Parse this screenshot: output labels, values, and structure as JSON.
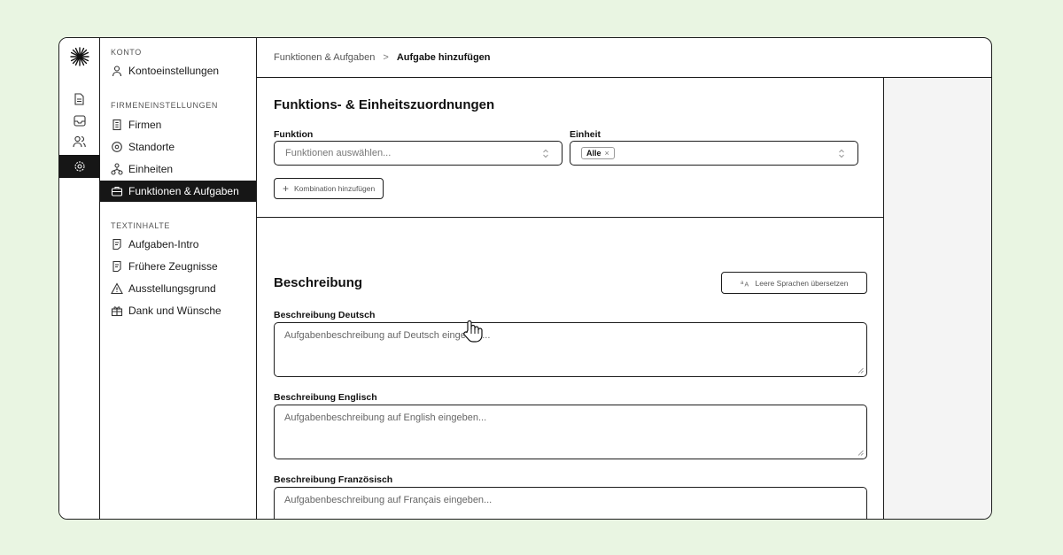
{
  "sidebar": {
    "sections": [
      {
        "title": "KONTO",
        "items": [
          {
            "label": "Kontoeinstellungen",
            "icon": "user-icon"
          }
        ]
      },
      {
        "title": "FIRMENEINSTELLUNGEN",
        "items": [
          {
            "label": "Firmen",
            "icon": "building-icon"
          },
          {
            "label": "Standorte",
            "icon": "map-pin-icon"
          },
          {
            "label": "Einheiten",
            "icon": "hierarchy-icon"
          },
          {
            "label": "Funktionen & Aufgaben",
            "icon": "briefcase-icon",
            "active": true
          }
        ]
      },
      {
        "title": "TEXTINHALTE",
        "items": [
          {
            "label": "Aufgaben-Intro",
            "icon": "text-doc-icon"
          },
          {
            "label": "Frühere Zeugnisse",
            "icon": "text-doc-icon"
          },
          {
            "label": "Ausstellungsgrund",
            "icon": "warning-icon"
          },
          {
            "label": "Dank und Wünsche",
            "icon": "gift-icon"
          }
        ]
      }
    ]
  },
  "breadcrumb": {
    "parent": "Funktionen & Aufgaben",
    "separator": ">",
    "current": "Aufgabe hinzufügen"
  },
  "assignments": {
    "title": "Funktions- & Einheitszuordnungen",
    "function_label": "Funktion",
    "function_placeholder": "Funktionen auswählen...",
    "unit_label": "Einheit",
    "unit_tag": "Alle",
    "unit_tag_remove": "×",
    "add_button": "Kombination hinzufügen"
  },
  "description": {
    "title": "Beschreibung",
    "translate_button": "Leere Sprachen übersetzen",
    "fields": [
      {
        "label": "Beschreibung Deutsch",
        "placeholder": "Aufgabenbeschreibung auf Deutsch eingeben..."
      },
      {
        "label": "Beschreibung Englisch",
        "placeholder": "Aufgabenbeschreibung auf English eingeben..."
      },
      {
        "label": "Beschreibung Französisch",
        "placeholder": "Aufgabenbeschreibung auf Français eingeben..."
      }
    ]
  },
  "colors": {
    "background": "#e9f5e2",
    "active": "#161616",
    "border": "#1c1c1c"
  }
}
